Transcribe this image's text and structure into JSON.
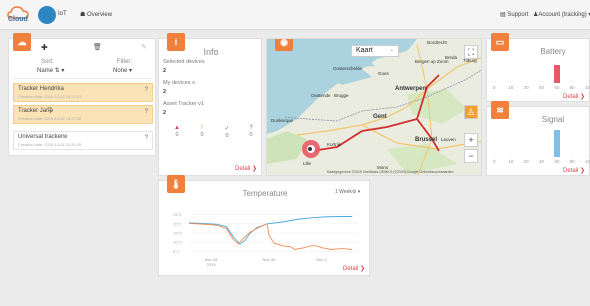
{
  "header": {
    "logo_text": "Cloud",
    "nav_iot": "IoT",
    "nav_overview": "Overview",
    "support": "Support",
    "account": "Account (tracking)"
  },
  "trackers": {
    "sort_label": "Sort:",
    "sort_value": "Name ⇅ ▾",
    "filter_label": "Filter:",
    "filter_value": "None ▾",
    "items": [
      {
        "name": "Tracker Hendrika",
        "date": "Creation date: 2019-12-02 14:27:23",
        "selected": true
      },
      {
        "name": "Tracker Jan͡ᵽ",
        "date": "Creation date: 2019-12-02 14:27:32",
        "selected": true
      },
      {
        "name": "Universal trackerᴡ",
        "date": "Creation date: 2019-12-01 11:25:35",
        "selected": false
      }
    ],
    "help": "?"
  },
  "info": {
    "title": "Info",
    "selected_label": "Selected devices",
    "selected_value": "2",
    "my_label": "My devices ≡",
    "my_value": "2",
    "asset_label": "Asset Tracker v1",
    "asset_value": "2",
    "status": [
      {
        "icon": "▲",
        "count": "0",
        "color": "#d9434a"
      },
      {
        "icon": "!",
        "count": "0",
        "color": "#e07b2e"
      },
      {
        "icon": "✓",
        "count": "0",
        "color": "#3aa757"
      },
      {
        "icon": "?",
        "count": "0",
        "color": "#777777"
      }
    ],
    "detail": "Detail ❯"
  },
  "map": {
    "select": "Kaart",
    "credit": "Kaartgegevens ©2019 GeoBasis-DE/BKG (©2009),Google   Gebruiksvoorwaarden",
    "labels": [
      {
        "text": "Dordrecht",
        "cls": "small"
      },
      {
        "text": "Breda",
        "cls": "small"
      },
      {
        "text": "Tilburg",
        "cls": "small"
      },
      {
        "text": "Bergen op Zoom",
        "cls": "small"
      },
      {
        "text": "Oosterschelde",
        "cls": "small"
      },
      {
        "text": "Goes",
        "cls": "small"
      },
      {
        "text": "Antwerpen",
        "cls": ""
      },
      {
        "text": "Oostende",
        "cls": "small"
      },
      {
        "text": "Brugge",
        "cls": "small"
      },
      {
        "text": "Gent",
        "cls": ""
      },
      {
        "text": "Dunkerque",
        "cls": "small"
      },
      {
        "text": "Kortrijk",
        "cls": "small"
      },
      {
        "text": "Brussel",
        "cls": ""
      },
      {
        "text": "Leuven",
        "cls": "small"
      },
      {
        "text": "Lille",
        "cls": "small"
      },
      {
        "text": "Mons",
        "cls": "small"
      }
    ]
  },
  "battery": {
    "title": "Battery",
    "ticks": [
      "0",
      "10",
      "20",
      "40",
      "60",
      "80",
      "10"
    ],
    "detail": "Detail ❯",
    "bar_color": "#e85a63",
    "bar_fraction": 0.8
  },
  "signal": {
    "title": "Signal",
    "ticks": [
      "0",
      "10",
      "20",
      "40",
      "60",
      "80",
      "10"
    ],
    "detail": "Detail ❯",
    "bar_color": "#7fbfe8",
    "bar_fraction": 0.95
  },
  "temperature": {
    "title": "Temperature",
    "range": "1 Week⚙ ▾",
    "detail": "Detail ❯",
    "chart_data": {
      "type": "line",
      "title": "Temperature",
      "yticks": [
        "25°C",
        "20°C",
        "15°C",
        "10°C",
        "5°C"
      ],
      "xticks": [
        "Nov 28\n2019",
        "Nov 30",
        "Dec 2"
      ],
      "ylim": [
        3,
        27
      ],
      "series": [
        {
          "color": "#4ea7dc",
          "values": [
            [
              0,
              20.5
            ],
            [
              0.08,
              20.2
            ],
            [
              0.16,
              19.8
            ],
            [
              0.22,
              18.5
            ],
            [
              0.26,
              13
            ],
            [
              0.3,
              9
            ],
            [
              0.33,
              11
            ],
            [
              0.36,
              15
            ],
            [
              0.4,
              18
            ],
            [
              0.46,
              20
            ],
            [
              0.55,
              21
            ],
            [
              0.64,
              22.5
            ],
            [
              0.72,
              23.3
            ],
            [
              0.8,
              23.8
            ],
            [
              0.88,
              24
            ],
            [
              0.96,
              24
            ]
          ]
        },
        {
          "color": "#f08d5a",
          "values": [
            [
              0,
              20.2
            ],
            [
              0.08,
              19.8
            ],
            [
              0.16,
              19.3
            ],
            [
              0.22,
              17.5
            ],
            [
              0.26,
              11.5
            ],
            [
              0.29,
              9
            ],
            [
              0.32,
              12
            ],
            [
              0.36,
              15.5
            ],
            [
              0.42,
              18.5
            ],
            [
              0.46,
              20
            ],
            [
              0.47,
              14
            ],
            [
              0.5,
              9.5
            ],
            [
              0.55,
              8
            ],
            [
              0.6,
              7.5
            ],
            [
              0.62,
              6
            ],
            [
              0.68,
              7
            ],
            [
              0.72,
              8
            ],
            [
              0.75,
              8
            ],
            [
              0.78,
              7
            ],
            [
              0.84,
              6
            ],
            [
              0.9,
              6.5
            ],
            [
              0.96,
              6
            ]
          ]
        }
      ]
    }
  }
}
